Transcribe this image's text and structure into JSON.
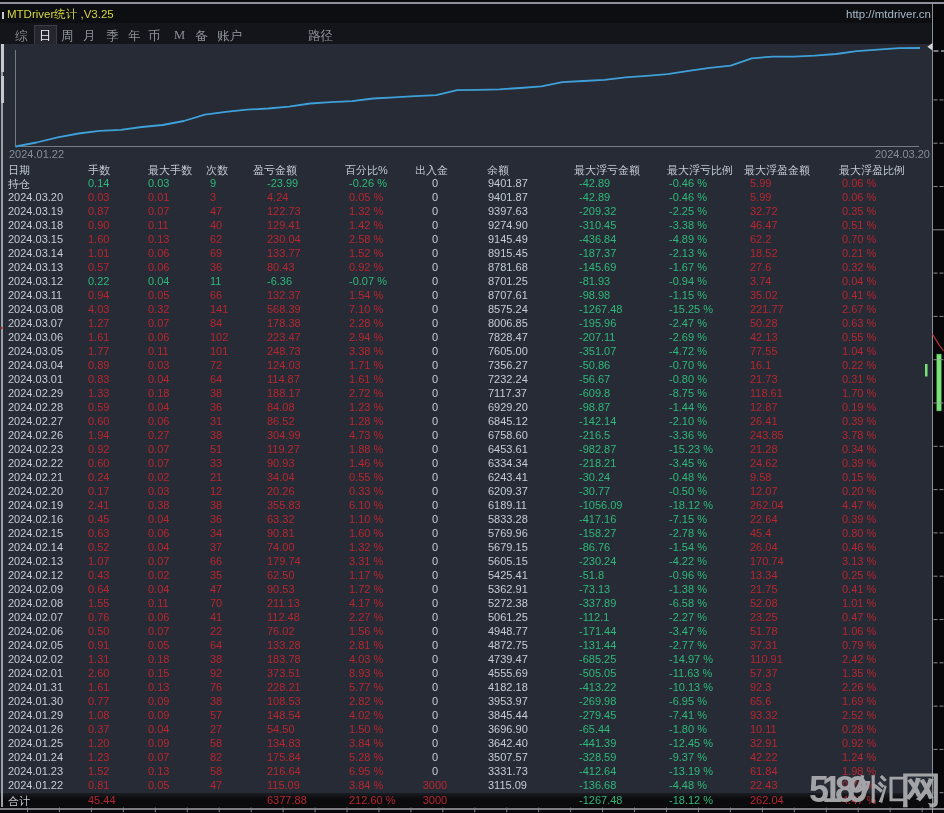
{
  "window": {
    "title": "MTDriver统计 ,V3.25",
    "url": "http://mtdriver.cn"
  },
  "menu": {
    "items": [
      "综",
      "日",
      "周",
      "月",
      "季",
      "年",
      "币",
      "M",
      "备",
      "账户",
      "路径"
    ],
    "selected": "日"
  },
  "chart_data": {
    "type": "line",
    "series_name": "余额",
    "x_start_label": "2024.01.22",
    "x_end_label": "2024.03.20",
    "start_balance": 3000,
    "dates": [
      "2024.01.22",
      "2024.01.23",
      "2024.01.24",
      "2024.01.25",
      "2024.01.26",
      "2024.01.29",
      "2024.01.30",
      "2024.01.31",
      "2024.02.01",
      "2024.02.02",
      "2024.02.05",
      "2024.02.06",
      "2024.02.07",
      "2024.02.08",
      "2024.02.09",
      "2024.02.12",
      "2024.02.13",
      "2024.02.14",
      "2024.02.15",
      "2024.02.16",
      "2024.02.19",
      "2024.02.20",
      "2024.02.21",
      "2024.02.22",
      "2024.02.23",
      "2024.02.26",
      "2024.02.27",
      "2024.02.28",
      "2024.02.29",
      "2024.03.01",
      "2024.03.04",
      "2024.03.05",
      "2024.03.06",
      "2024.03.07",
      "2024.03.08",
      "2024.03.11",
      "2024.03.12",
      "2024.03.13",
      "2024.03.14",
      "2024.03.15",
      "2024.03.18",
      "2024.03.19",
      "2024.03.20"
    ],
    "balances": [
      3115.09,
      3331.73,
      3507.57,
      3642.4,
      3696.9,
      3845.44,
      3953.97,
      4182.18,
      4555.69,
      4739.47,
      4872.75,
      4948.77,
      5061.25,
      5272.38,
      5362.91,
      5425.41,
      5605.15,
      5679.15,
      5769.96,
      5833.28,
      6189.11,
      6209.37,
      6243.41,
      6334.34,
      6453.61,
      6758.6,
      6845.12,
      6929.2,
      7117.37,
      7232.24,
      7356.27,
      7605.0,
      7828.47,
      8006.85,
      8575.24,
      8707.61,
      8701.25,
      8781.68,
      8915.45,
      9145.49,
      9274.9,
      9397.63,
      9401.87
    ],
    "ylim": [
      3000,
      9401.87
    ],
    "line_color": "#3fa0d9",
    "grid": false,
    "legend": false
  },
  "table": {
    "headers": [
      "日期",
      "手数",
      "最大手数",
      "次数",
      "盈亏金额",
      "百分比%",
      "出入金",
      "余额",
      "最大浮亏金额",
      "最大浮亏比例",
      "最大浮盈金额",
      "最大浮盈比例"
    ],
    "rows": [
      [
        "持仓",
        "0.14",
        "0.03",
        "9",
        "-23.99",
        "-0.26 %",
        "0",
        "9401.87",
        "-42.89",
        "-0.46 %",
        "5.99",
        "0.06 %",
        "g"
      ],
      [
        "2024.03.20",
        "0.03",
        "0.01",
        "3",
        "4.24",
        "0.05 %",
        "0",
        "9401.87",
        "-42.89",
        "-0.46 %",
        "5.99",
        "0.06 %",
        "r"
      ],
      [
        "2024.03.19",
        "0.87",
        "0.07",
        "47",
        "122.73",
        "1.32 %",
        "0",
        "9397.63",
        "-209.32",
        "-2.25 %",
        "32.72",
        "0.35 %",
        "r"
      ],
      [
        "2024.03.18",
        "0.90",
        "0.11",
        "40",
        "129.41",
        "1.42 %",
        "0",
        "9274.90",
        "-310.45",
        "-3.38 %",
        "46.47",
        "0.51 %",
        "r"
      ],
      [
        "2024.03.15",
        "1.60",
        "0.13",
        "62",
        "230.04",
        "2.58 %",
        "0",
        "9145.49",
        "-436.84",
        "-4.89 %",
        "62.2",
        "0.70 %",
        "r"
      ],
      [
        "2024.03.14",
        "1.01",
        "0.06",
        "69",
        "133.77",
        "1.52 %",
        "0",
        "8915.45",
        "-187.37",
        "-2.13 %",
        "18.52",
        "0.21 %",
        "r"
      ],
      [
        "2024.03.13",
        "0.57",
        "0.06",
        "36",
        "80.43",
        "0.92 %",
        "0",
        "8781.68",
        "-145.69",
        "-1.67 %",
        "27.6",
        "0.32 %",
        "r"
      ],
      [
        "2024.03.12",
        "0.22",
        "0.04",
        "11",
        "-6.36",
        "-0.07 %",
        "0",
        "8701.25",
        "-81.93",
        "-0.94 %",
        "3.74",
        "0.04 %",
        "g"
      ],
      [
        "2024.03.11",
        "0.94",
        "0.05",
        "66",
        "132.37",
        "1.54 %",
        "0",
        "8707.61",
        "-98.98",
        "-1.15 %",
        "35.02",
        "0.41 %",
        "r"
      ],
      [
        "2024.03.08",
        "4.03",
        "0.32",
        "141",
        "568.39",
        "7.10 %",
        "0",
        "8575.24",
        "-1267.48",
        "-15.25 %",
        "221.77",
        "2.67 %",
        "r"
      ],
      [
        "2024.03.07",
        "1.27",
        "0.07",
        "84",
        "178.38",
        "2.28 %",
        "0",
        "8006.85",
        "-195.96",
        "-2.47 %",
        "50.28",
        "0.63 %",
        "r"
      ],
      [
        "2024.03.06",
        "1.61",
        "0.06",
        "102",
        "223.47",
        "2.94 %",
        "0",
        "7828.47",
        "-207.11",
        "-2.69 %",
        "42.13",
        "0.55 %",
        "r"
      ],
      [
        "2024.03.05",
        "1.77",
        "0.11",
        "101",
        "248.73",
        "3.38 %",
        "0",
        "7605.00",
        "-351.07",
        "-4.72 %",
        "77.55",
        "1.04 %",
        "r"
      ],
      [
        "2024.03.04",
        "0.89",
        "0.03",
        "72",
        "124.03",
        "1.71 %",
        "0",
        "7356.27",
        "-50.86",
        "-0.70 %",
        "16.1",
        "0.22 %",
        "r"
      ],
      [
        "2024.03.01",
        "0.83",
        "0.04",
        "64",
        "114.87",
        "1.61 %",
        "0",
        "7232.24",
        "-56.67",
        "-0.80 %",
        "21.73",
        "0.31 %",
        "r"
      ],
      [
        "2024.02.29",
        "1.33",
        "0.18",
        "38",
        "188.17",
        "2.72 %",
        "0",
        "7117.37",
        "-609.8",
        "-8.75 %",
        "118.61",
        "1.70 %",
        "r"
      ],
      [
        "2024.02.28",
        "0.59",
        "0.04",
        "36",
        "84.08",
        "1.23 %",
        "0",
        "6929.20",
        "-98.87",
        "-1.44 %",
        "12.87",
        "0.19 %",
        "r"
      ],
      [
        "2024.02.27",
        "0.60",
        "0.06",
        "31",
        "86.52",
        "1.28 %",
        "0",
        "6845.12",
        "-142.14",
        "-2.10 %",
        "26.41",
        "0.39 %",
        "r"
      ],
      [
        "2024.02.26",
        "1.94",
        "0.27",
        "38",
        "304.99",
        "4.73 %",
        "0",
        "6758.60",
        "-216.5",
        "-3.36 %",
        "243.85",
        "3.78 %",
        "r"
      ],
      [
        "2024.02.23",
        "0.92",
        "0.07",
        "51",
        "119.27",
        "1.88 %",
        "0",
        "6453.61",
        "-982.87",
        "-15.23 %",
        "21.28",
        "0.34 %",
        "r"
      ],
      [
        "2024.02.22",
        "0.60",
        "0.07",
        "33",
        "90.93",
        "1.46 %",
        "0",
        "6334.34",
        "-218.21",
        "-3.45 %",
        "24.62",
        "0.39 %",
        "r"
      ],
      [
        "2024.02.21",
        "0.24",
        "0.02",
        "21",
        "34.04",
        "0.55 %",
        "0",
        "6243.41",
        "-30.24",
        "-0.48 %",
        "9.58",
        "0.15 %",
        "r"
      ],
      [
        "2024.02.20",
        "0.17",
        "0.03",
        "12",
        "20.26",
        "0.33 %",
        "0",
        "6209.37",
        "-30.77",
        "-0.50 %",
        "12.07",
        "0.20 %",
        "r"
      ],
      [
        "2024.02.19",
        "2.41",
        "0.38",
        "38",
        "355.83",
        "6.10 %",
        "0",
        "6189.11",
        "-1056.09",
        "-18.12 %",
        "262.04",
        "4.47 %",
        "r"
      ],
      [
        "2024.02.16",
        "0.45",
        "0.04",
        "36",
        "63.32",
        "1.10 %",
        "0",
        "5833.28",
        "-417.16",
        "-7.15 %",
        "22.64",
        "0.39 %",
        "r"
      ],
      [
        "2024.02.15",
        "0.63",
        "0.06",
        "34",
        "90.81",
        "1.60 %",
        "0",
        "5769.96",
        "-158.27",
        "-2.78 %",
        "45.4",
        "0.80 %",
        "r"
      ],
      [
        "2024.02.14",
        "0.52",
        "0.04",
        "37",
        "74.00",
        "1.32 %",
        "0",
        "5679.15",
        "-86.76",
        "-1.54 %",
        "26.04",
        "0.46 %",
        "r"
      ],
      [
        "2024.02.13",
        "1.07",
        "0.07",
        "66",
        "179.74",
        "3.31 %",
        "0",
        "5605.15",
        "-230.24",
        "-4.22 %",
        "170.74",
        "3.13 %",
        "r"
      ],
      [
        "2024.02.12",
        "0.43",
        "0.02",
        "35",
        "62.50",
        "1.17 %",
        "0",
        "5425.41",
        "-51.8",
        "-0.96 %",
        "13.34",
        "0.25 %",
        "r"
      ],
      [
        "2024.02.09",
        "0.64",
        "0.04",
        "47",
        "90.53",
        "1.72 %",
        "0",
        "5362.91",
        "-73.13",
        "-1.38 %",
        "21.75",
        "0.41 %",
        "r"
      ],
      [
        "2024.02.08",
        "1.55",
        "0.11",
        "70",
        "211.13",
        "4.17 %",
        "0",
        "5272.38",
        "-337.89",
        "-6.58 %",
        "52.08",
        "1.01 %",
        "r"
      ],
      [
        "2024.02.07",
        "0.76",
        "0.06",
        "41",
        "112.48",
        "2.27 %",
        "0",
        "5061.25",
        "-112.1",
        "-2.27 %",
        "23.25",
        "0.47 %",
        "r"
      ],
      [
        "2024.02.06",
        "0.50",
        "0.07",
        "22",
        "76.02",
        "1.56 %",
        "0",
        "4948.77",
        "-171.44",
        "-3.47 %",
        "51.78",
        "1.06 %",
        "r"
      ],
      [
        "2024.02.05",
        "0.91",
        "0.05",
        "64",
        "133.28",
        "2.81 %",
        "0",
        "4872.75",
        "-131.44",
        "-2.77 %",
        "37.31",
        "0.79 %",
        "r"
      ],
      [
        "2024.02.02",
        "1.31",
        "0.18",
        "38",
        "183.78",
        "4.03 %",
        "0",
        "4739.47",
        "-685.25",
        "-14.97 %",
        "110.91",
        "2.42 %",
        "r"
      ],
      [
        "2024.02.01",
        "2.60",
        "0.15",
        "92",
        "373.51",
        "8.93 %",
        "0",
        "4555.69",
        "-505.05",
        "-11.63 %",
        "57.37",
        "1.35 %",
        "r"
      ],
      [
        "2024.01.31",
        "1.61",
        "0.13",
        "76",
        "228.21",
        "5.77 %",
        "0",
        "4182.18",
        "-413.22",
        "-10.13 %",
        "92.3",
        "2.26 %",
        "r"
      ],
      [
        "2024.01.30",
        "0.77",
        "0.09",
        "38",
        "108.53",
        "2.82 %",
        "0",
        "3953.97",
        "-269.98",
        "-6.95 %",
        "65.6",
        "1.69 %",
        "r"
      ],
      [
        "2024.01.29",
        "1.08",
        "0.09",
        "57",
        "148.54",
        "4.02 %",
        "0",
        "3845.44",
        "-279.45",
        "-7.41 %",
        "93.32",
        "2.52 %",
        "r"
      ],
      [
        "2024.01.26",
        "0.37",
        "0.04",
        "27",
        "54.50",
        "1.50 %",
        "0",
        "3696.90",
        "-65.44",
        "-1.80 %",
        "10.11",
        "0.28 %",
        "r"
      ],
      [
        "2024.01.25",
        "1.20",
        "0.09",
        "58",
        "134.83",
        "3.84 %",
        "0",
        "3642.40",
        "-441.39",
        "-12.45 %",
        "32.91",
        "0.92 %",
        "r"
      ],
      [
        "2024.01.24",
        "1.23",
        "0.07",
        "82",
        "175.84",
        "5.28 %",
        "0",
        "3507.57",
        "-328.59",
        "-9.37 %",
        "42.22",
        "1.24 %",
        "r"
      ],
      [
        "2024.01.23",
        "1.52",
        "0.13",
        "58",
        "216.64",
        "6.95 %",
        "0",
        "3331.73",
        "-412.64",
        "-13.19 %",
        "61.84",
        "1.98 %",
        "r"
      ],
      [
        "2024.01.22",
        "0.81",
        "0.05",
        "47",
        "115.09",
        "3.84 %",
        "3000",
        "3115.09",
        "-136.68",
        "-4.48 %",
        "22.43",
        "0.72 %",
        "r"
      ]
    ],
    "totals": [
      "合计",
      "45.44",
      "",
      "",
      "6377.88",
      "212.60 %",
      "3000",
      "",
      "-1267.48",
      "-18.12 %",
      "262.04",
      "4.47 %"
    ]
  },
  "watermark": {
    "text": "5189外汇网",
    "digits": "5189",
    "hanzi_mid": "外汇",
    "hanzi_last": "网"
  },
  "colors": {
    "gain_red": "#b8262f",
    "loss_green": "#2fb878",
    "text_white": "#c6ccd4",
    "title_yellow": "#d6d63e",
    "curve_blue": "#3fa0d9",
    "table_bg": "#262b35",
    "bar_bg": "#0d0e12"
  }
}
